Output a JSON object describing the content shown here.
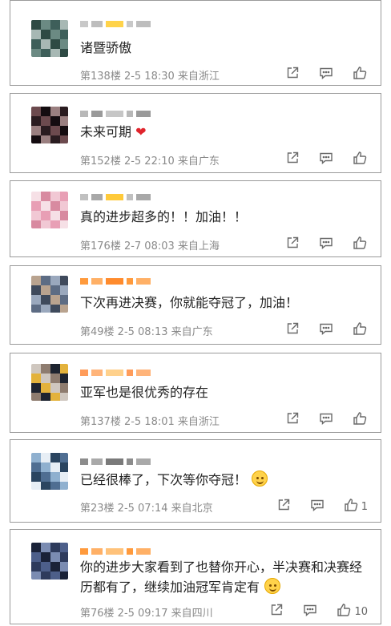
{
  "comments": [
    {
      "name": "",
      "content": "诸暨骄傲",
      "meta": "第138楼  2-5 18:30  来自浙江",
      "likes": "",
      "avatar_colors": [
        "#2e4a44",
        "#6b8a83",
        "#3e5f5a",
        "#a7b8b4"
      ],
      "name_colors": [
        "#c8c8c8",
        "#bdbdbd",
        "#ffd34a"
      ]
    },
    {
      "name": "",
      "content": "未来可期",
      "emoji": "❤",
      "meta": "第152楼  2-5 22:10  来自广东",
      "likes": "",
      "avatar_colors": [
        "#2a1c20",
        "#6c4a4e",
        "#140c10",
        "#9a7f80"
      ],
      "name_colors": [
        "#b8b8b8",
        "#9a9a9a",
        "#c6c6c6"
      ]
    },
    {
      "name": "",
      "content": "真的进步超多的！！加油！！",
      "meta": "第176楼  2-7 08:03  来自上海",
      "likes": "",
      "avatar_colors": [
        "#f1c8d4",
        "#e89fb5",
        "#f6e0e6",
        "#d88aa0"
      ],
      "name_colors": [
        "#c0c0c0",
        "#a8a8a8",
        "#ffca3a"
      ]
    },
    {
      "name": "",
      "content": "下次再进决赛，你就能夺冠了，加油！",
      "meta": "第49楼  2-5 08:13  来自广东",
      "likes": "",
      "avatar_colors": [
        "#5d6c84",
        "#9aa8bd",
        "#3f4a5c",
        "#b9a38f"
      ],
      "name_colors": [
        "#ff9a3c",
        "#ffb066",
        "#ff8b2d"
      ]
    },
    {
      "name": "",
      "content": "亚军也是很优秀的存在",
      "meta": "第137楼  2-5 18:01  来自浙江",
      "likes": "",
      "avatar_colors": [
        "#cfc7bf",
        "#8e7c6f",
        "#1e2430",
        "#e3b23c"
      ],
      "name_colors": [
        "#ff9c5a",
        "#ffb47a",
        "#ffd18c"
      ]
    },
    {
      "name": "",
      "content": "已经很棒了，下次等你夺冠！",
      "emoji": "smile",
      "meta": "第23楼  2-5 07:14  来自北京",
      "likes": "1",
      "avatar_colors": [
        "#4f6e92",
        "#8fb0cf",
        "#e7eef5",
        "#2b4560"
      ],
      "name_colors": [
        "#8c8c8c",
        "#a9a9a9",
        "#7a7a7a"
      ]
    },
    {
      "name": "",
      "content": "你的进步大家看到了也替你开心，半决赛和决赛经历都有了，继续加油冠军肯定有",
      "emoji": "blush",
      "meta": "第76楼  2-5 09:17  来自四川",
      "likes": "10",
      "avatar_colors": [
        "#2e3b5c",
        "#4d5f8a",
        "#1a2238",
        "#7b8cb2"
      ],
      "name_colors": [
        "#ff9a3c",
        "#ffb066",
        "#ffc27a"
      ]
    }
  ],
  "icons": {
    "share": "share-icon",
    "reply": "comment-icon",
    "like": "thumbs-up-icon"
  }
}
